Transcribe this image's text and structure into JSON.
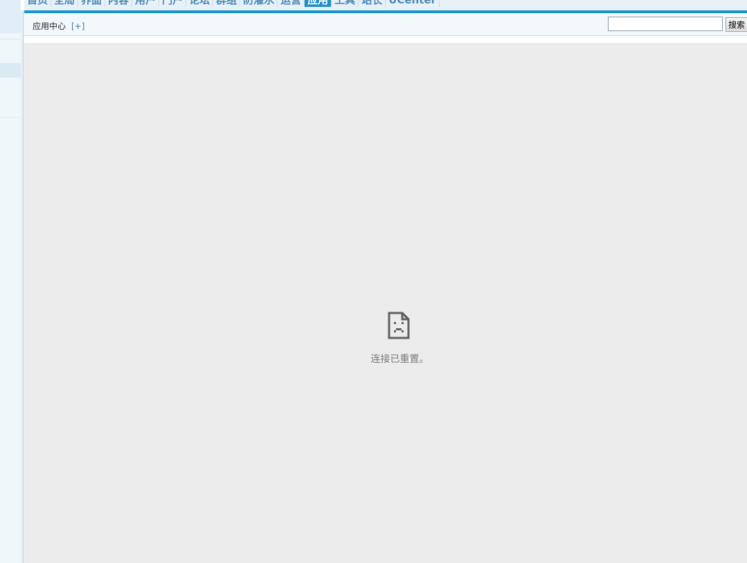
{
  "nav": {
    "items": [
      {
        "label": "首页"
      },
      {
        "label": "全局"
      },
      {
        "label": "界面"
      },
      {
        "label": "内容"
      },
      {
        "label": "用户"
      },
      {
        "label": "门户"
      },
      {
        "label": "论坛"
      },
      {
        "label": "群组"
      },
      {
        "label": "防灌水"
      },
      {
        "label": "运营"
      },
      {
        "label": "应用",
        "active": true
      },
      {
        "label": "工具"
      },
      {
        "label": "站长"
      },
      {
        "label": "UCenter"
      }
    ]
  },
  "subheader": {
    "title": "应用中心",
    "add_link": "[+]"
  },
  "search": {
    "value": "",
    "button_label": "搜索"
  },
  "error": {
    "message": "连接已重置。",
    "icon": "sad-page-icon"
  },
  "colors": {
    "accent": "#1794cb",
    "nav_text": "#4d8bb3",
    "error_bg": "#ececec",
    "error_text": "#7a7a7a"
  }
}
